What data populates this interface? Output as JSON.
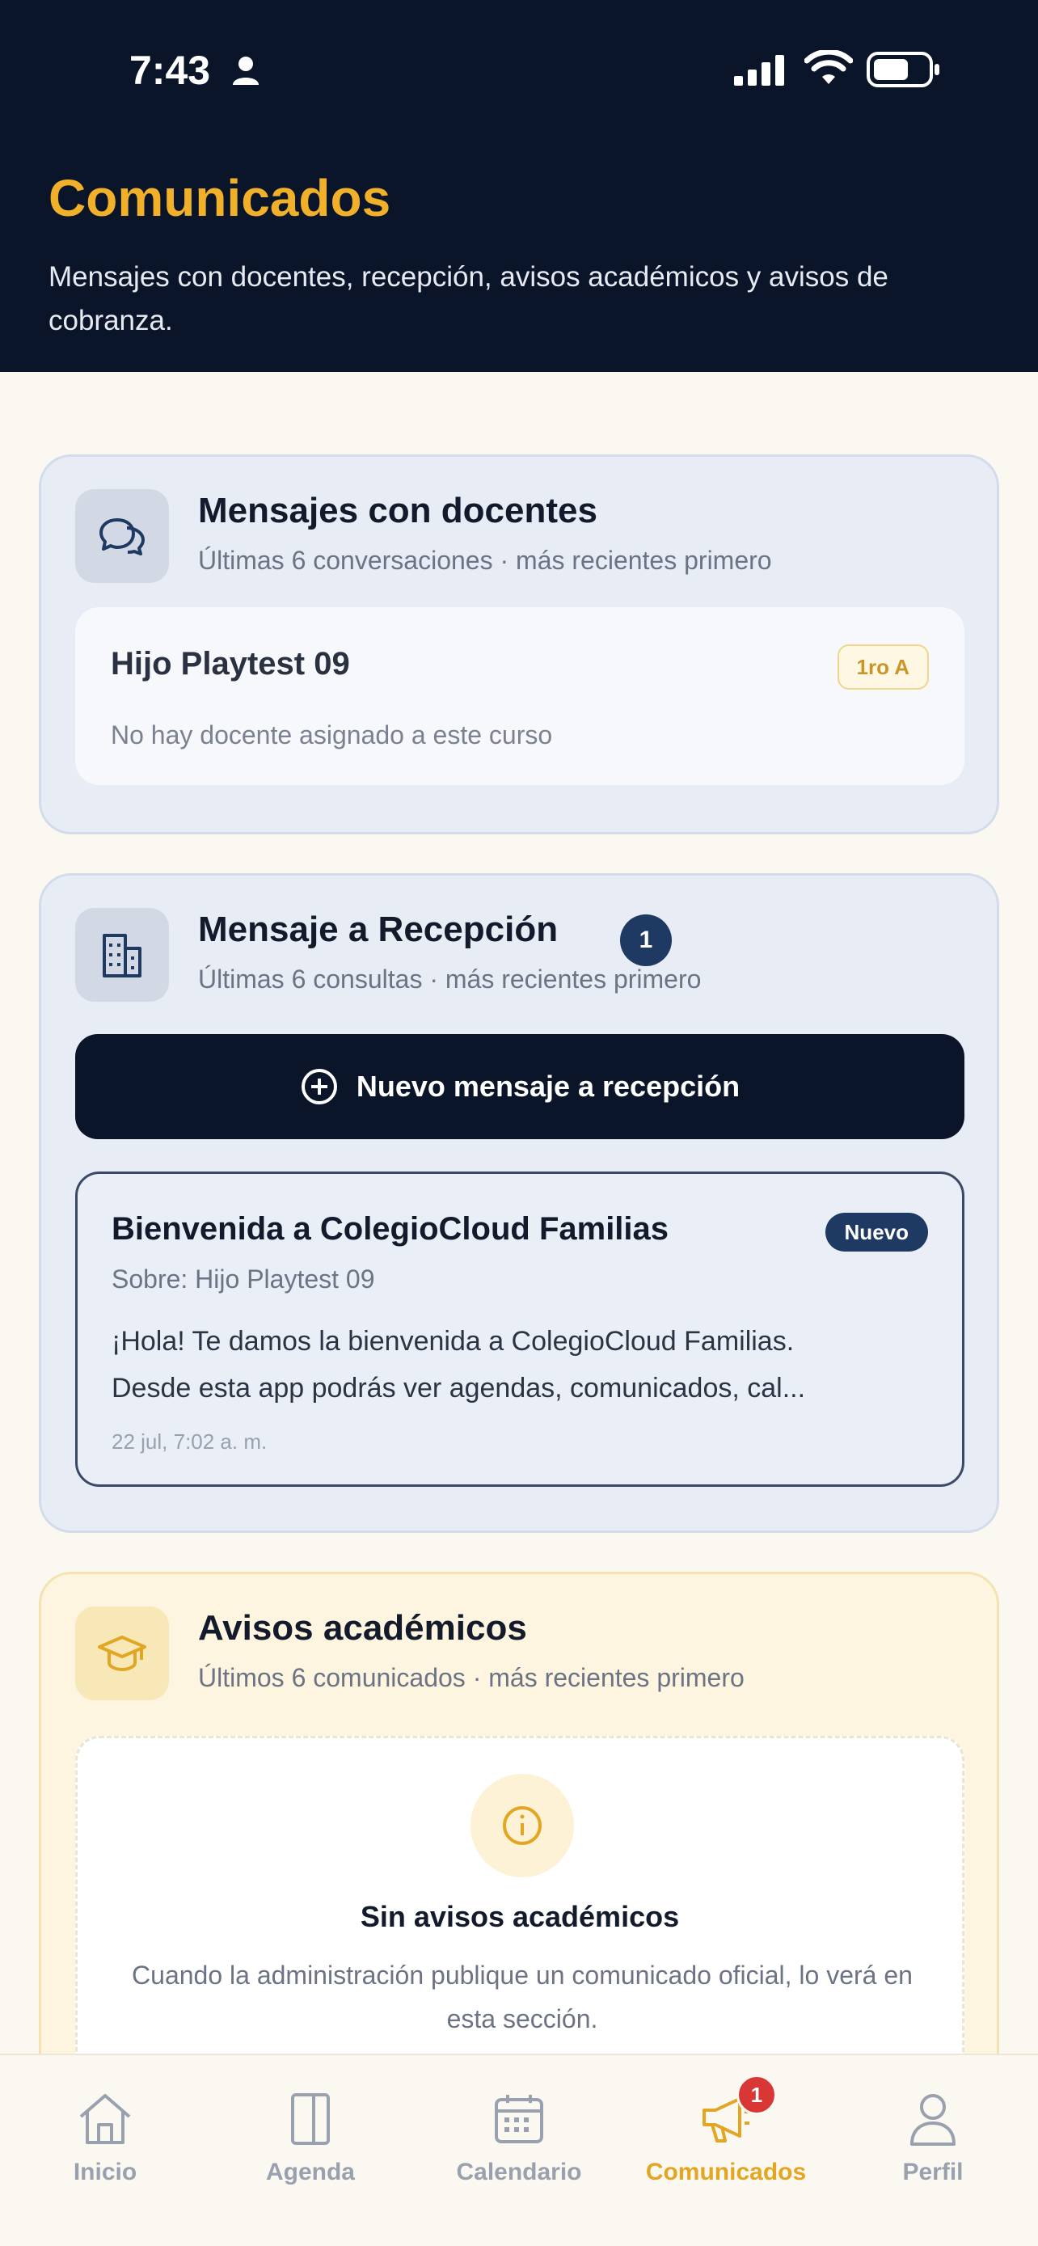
{
  "status_bar": {
    "time": "7:43"
  },
  "header": {
    "title": "Comunicados",
    "subtitle": "Mensajes con docentes, recepción, avisos académicos y avisos de cobranza."
  },
  "teachers": {
    "title": "Mensajes con docentes",
    "meta": "Últimas 6 conversaciones · más recientes primero",
    "student_name": "Hijo Playtest 09",
    "course": "1ro A",
    "note": "No hay docente asignado a este curso"
  },
  "reception": {
    "title": "Mensaje a Recepción",
    "count": "1",
    "meta": "Últimas 6 consultas · más recientes primero",
    "new_button_label": "Nuevo mensaje a recepción",
    "message": {
      "title": "Bienvenida a ColegioCloud Familias",
      "badge": "Nuevo",
      "about": "Sobre: Hijo Playtest 09",
      "body_line1": "¡Hola! Te damos la bienvenida a ColegioCloud Familias.",
      "body_line2": "Desde esta app podrás ver agendas, comunicados, cal...",
      "date": "22 jul, 7:02 a. m."
    }
  },
  "academic": {
    "title": "Avisos académicos",
    "meta": "Últimos 6 comunicados · más recientes primero",
    "empty_title": "Sin avisos académicos",
    "empty_text": "Cuando la administración publique un comunicado oficial, lo verá en esta sección."
  },
  "nav": {
    "items": [
      {
        "label": "Inicio",
        "icon": "home-icon"
      },
      {
        "label": "Agenda",
        "icon": "book-icon"
      },
      {
        "label": "Calendario",
        "icon": "calendar-icon"
      },
      {
        "label": "Comunicados",
        "icon": "megaphone-icon",
        "badge": "1",
        "active": true
      },
      {
        "label": "Perfil",
        "icon": "user-icon"
      }
    ]
  },
  "colors": {
    "header_bg": "#0b1529",
    "accent": "#f0b02a",
    "badge_blue": "#1e3a63",
    "nav_badge_red": "#d93636"
  }
}
